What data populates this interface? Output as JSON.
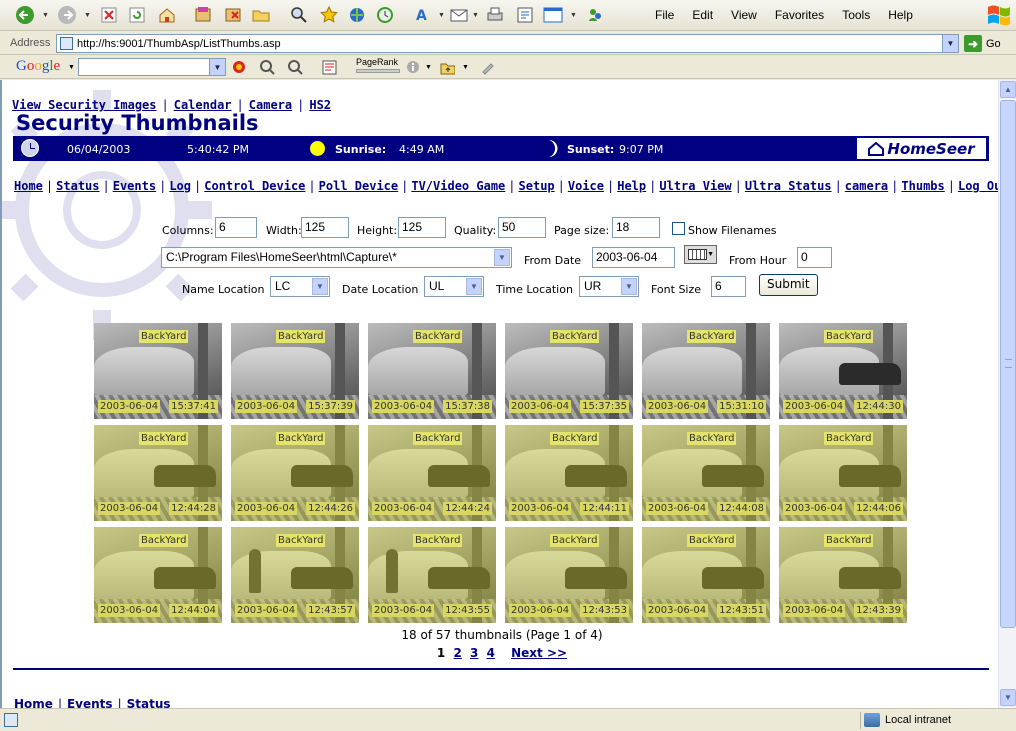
{
  "browser": {
    "menu": [
      "File",
      "Edit",
      "View",
      "Favorites",
      "Tools",
      "Help"
    ],
    "address_label": "Address",
    "url": "http://hs:9001/ThumbAsp/ListThumbs.asp",
    "go_label": "Go",
    "google_logo": "Google",
    "pagerank_label": "PageRank",
    "status_zone": "Local intranet"
  },
  "page": {
    "top_links": [
      "View Security Images",
      "Calendar",
      "Camera",
      "HS2"
    ],
    "title": "Security Thumbnails",
    "status": {
      "date": "06/04/2003",
      "time": "5:40:42 PM",
      "sunrise_label": "Sunrise:",
      "sunrise": "4:49 AM",
      "sunset_label": "Sunset:",
      "sunset": "9:07 PM",
      "logo": "HomeSeer"
    },
    "nav_links": [
      "Home",
      "Status",
      "Events",
      "Log",
      "Control Device",
      "Poll Device",
      "TV/Video Game",
      "Setup",
      "Voice",
      "Help",
      "Ultra View",
      "Ultra Status",
      "camera",
      "Thumbs",
      "Log Out"
    ],
    "form": {
      "columns_label": "Columns:",
      "columns": "6",
      "width_label": "Width:",
      "width": "125",
      "height_label": "Height:",
      "height": "125",
      "quality_label": "Quality:",
      "quality": "50",
      "pagesize_label": "Page size:",
      "pagesize": "18",
      "show_filenames_label": "Show Filenames",
      "path": "C:\\Program Files\\HomeSeer\\html\\Capture\\*",
      "from_date_label": "From Date",
      "from_date": "2003-06-04",
      "from_hour_label": "From Hour",
      "from_hour": "0",
      "name_location_label": "Name Location",
      "name_location": "LC",
      "date_location_label": "Date Location",
      "date_location": "UL",
      "time_location_label": "Time Location",
      "time_location": "UR",
      "font_size_label": "Font Size",
      "font_size": "6",
      "submit_label": "Submit"
    },
    "thumbnails": [
      {
        "name": "BackYard",
        "date": "2003-06-04",
        "time": "15:37:41"
      },
      {
        "name": "BackYard",
        "date": "2003-06-04",
        "time": "15:37:39"
      },
      {
        "name": "BackYard",
        "date": "2003-06-04",
        "time": "15:37:38"
      },
      {
        "name": "BackYard",
        "date": "2003-06-04",
        "time": "15:37:35"
      },
      {
        "name": "BackYard",
        "date": "2003-06-04",
        "time": "15:31:10"
      },
      {
        "name": "BackYard",
        "date": "2003-06-04",
        "time": "12:44:30"
      },
      {
        "name": "BackYard",
        "date": "2003-06-04",
        "time": "12:44:28"
      },
      {
        "name": "BackYard",
        "date": "2003-06-04",
        "time": "12:44:26"
      },
      {
        "name": "BackYard",
        "date": "2003-06-04",
        "time": "12:44:24"
      },
      {
        "name": "BackYard",
        "date": "2003-06-04",
        "time": "12:44:11"
      },
      {
        "name": "BackYard",
        "date": "2003-06-04",
        "time": "12:44:08"
      },
      {
        "name": "BackYard",
        "date": "2003-06-04",
        "time": "12:44:06"
      },
      {
        "name": "BackYard",
        "date": "2003-06-04",
        "time": "12:44:04"
      },
      {
        "name": "BackYard",
        "date": "2003-06-04",
        "time": "12:43:57"
      },
      {
        "name": "BackYard",
        "date": "2003-06-04",
        "time": "12:43:55"
      },
      {
        "name": "BackYard",
        "date": "2003-06-04",
        "time": "12:43:53"
      },
      {
        "name": "BackYard",
        "date": "2003-06-04",
        "time": "12:43:51"
      },
      {
        "name": "BackYard",
        "date": "2003-06-04",
        "time": "12:43:39"
      }
    ],
    "summary": "18 of 57 thumbnails (Page 1 of 4)",
    "pager": {
      "current": "1",
      "pages": [
        "2",
        "3",
        "4"
      ],
      "next": "Next >>"
    },
    "footer_links": [
      "Home",
      "Events",
      "Status"
    ]
  }
}
